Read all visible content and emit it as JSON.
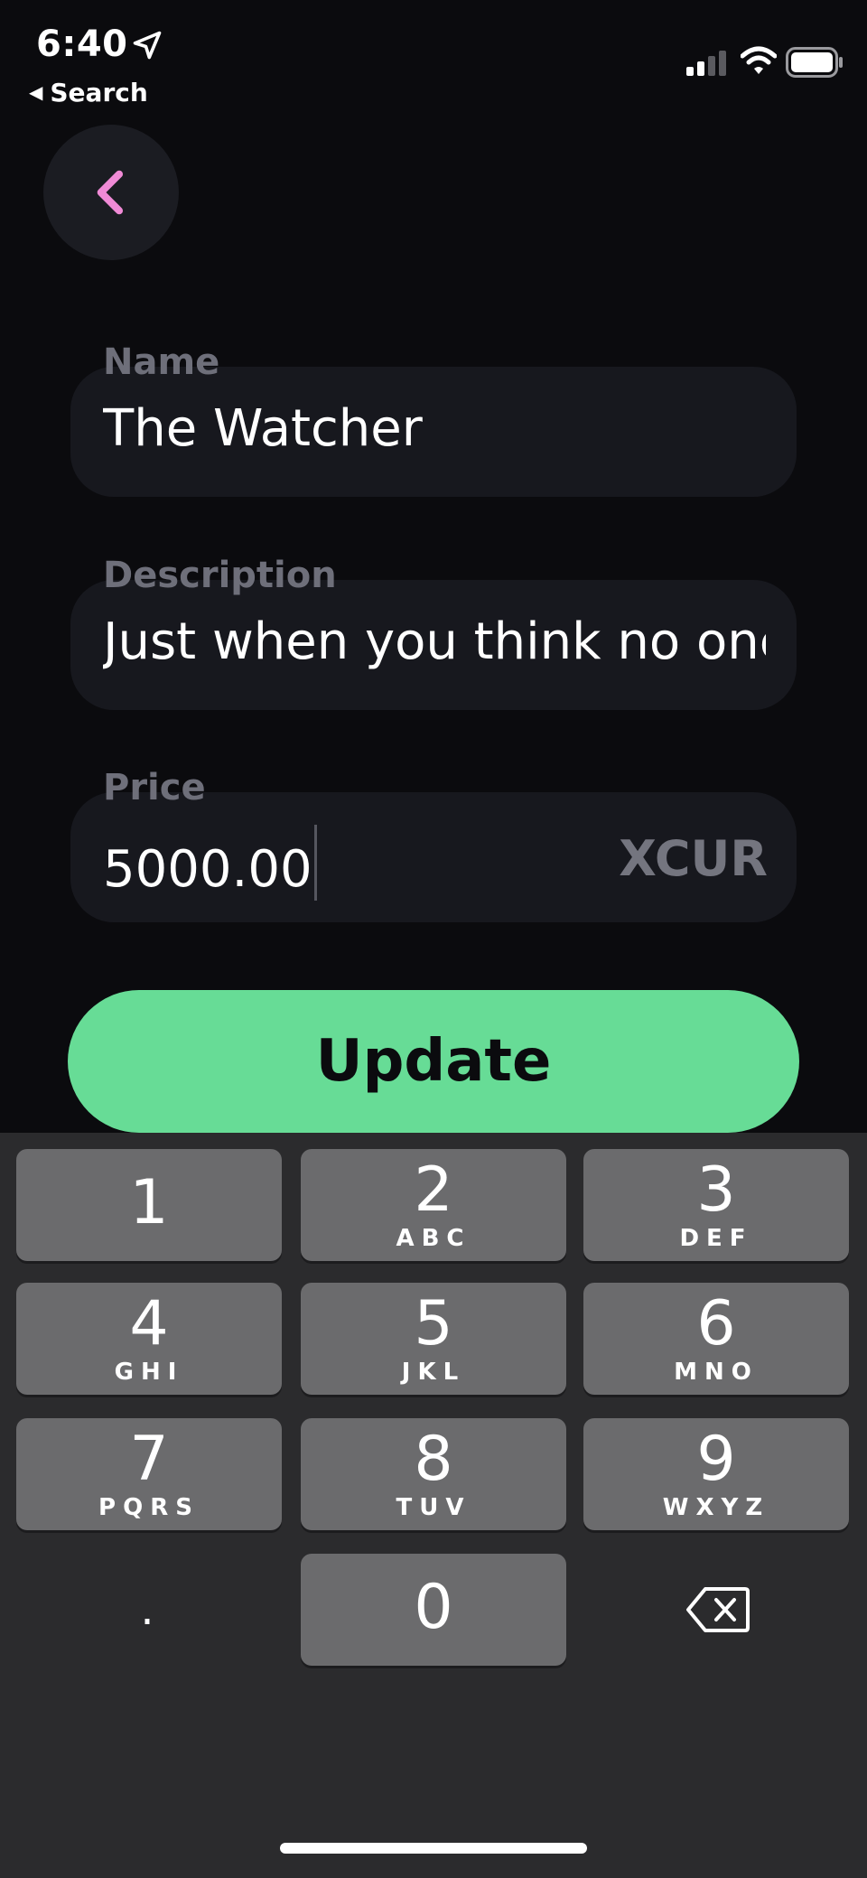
{
  "status": {
    "time": "6:40",
    "back_app": "Search"
  },
  "form": {
    "name_label": "Name",
    "name_value": "The Watcher",
    "description_label": "Description",
    "description_value": "Just when you think no one",
    "price_label": "Price",
    "price_value": "5000.00",
    "currency": "XCUR"
  },
  "update_label": "Update",
  "keypad": {
    "k1": {
      "num": "1",
      "letters": ""
    },
    "k2": {
      "num": "2",
      "letters": "ABC"
    },
    "k3": {
      "num": "3",
      "letters": "DEF"
    },
    "k4": {
      "num": "4",
      "letters": "GHI"
    },
    "k5": {
      "num": "5",
      "letters": "JKL"
    },
    "k6": {
      "num": "6",
      "letters": "MNO"
    },
    "k7": {
      "num": "7",
      "letters": "PQRS"
    },
    "k8": {
      "num": "8",
      "letters": "TUV"
    },
    "k9": {
      "num": "9",
      "letters": "WXYZ"
    },
    "k0": {
      "num": "0"
    },
    "dot": "."
  },
  "colors": {
    "accent_green": "#67dc96",
    "back_chevron": "#f08ad6"
  }
}
